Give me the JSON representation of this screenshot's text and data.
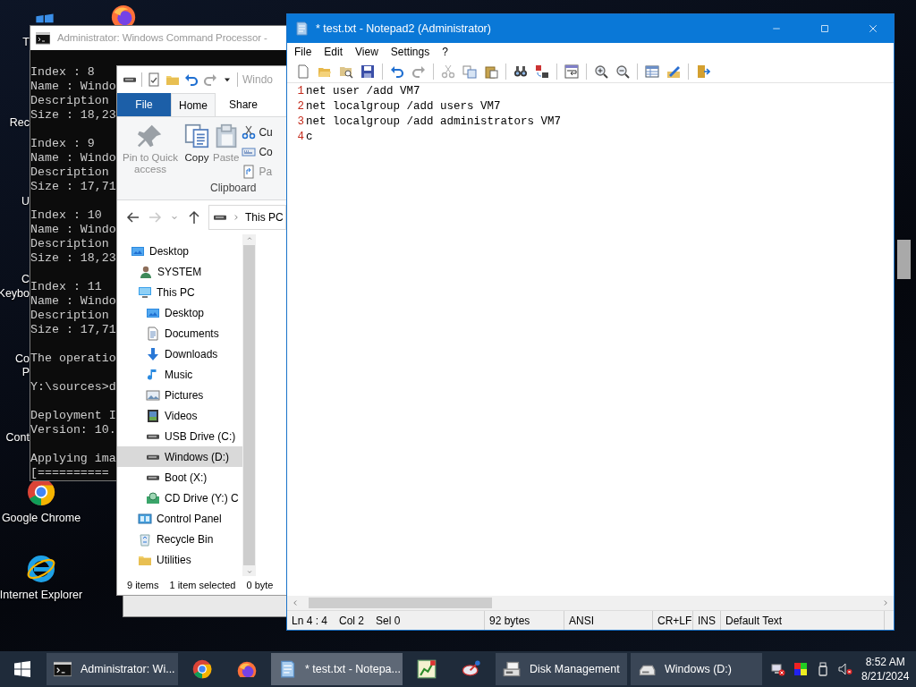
{
  "desktop": {
    "icons": [
      {
        "lines": [
          "T"
        ]
      },
      {
        "lines": [
          "Rec"
        ]
      },
      {
        "lines": [
          "U"
        ]
      },
      {
        "lines": [
          "C",
          "Keybo"
        ]
      },
      {
        "lines": [
          "Co",
          "P"
        ]
      },
      {
        "lines": [
          "Cont"
        ]
      },
      {
        "lines": [
          "Google Chrome"
        ]
      },
      {
        "lines": [
          "Internet Explorer"
        ]
      }
    ]
  },
  "command_window": {
    "title": "Administrator: Windows Command Processor -",
    "blocks": [
      [
        "Index : 8",
        "Name : Windo",
        "Description",
        "Size : 18,23"
      ],
      [
        "Index : 9",
        "Name : Windo",
        "Description",
        "Size : 17,71"
      ],
      [
        "Index : 10",
        "Name : Windo",
        "Description",
        "Size : 18,23"
      ],
      [
        "Index : 11",
        "Name : Windo",
        "Description",
        "Size : 17,71"
      ],
      [
        "The operatio"
      ],
      [
        "Y:\\sources>d"
      ],
      [
        "Deployment I",
        "Version: 10."
      ],
      [
        "Applying ima",
        "[=========="
      ]
    ]
  },
  "explorer": {
    "title": "Windo",
    "tabs": [
      {
        "label": "File",
        "kind": "file",
        "selected": false
      },
      {
        "label": "Home",
        "kind": "tab",
        "selected": true
      },
      {
        "label": "Share",
        "kind": "tab",
        "selected": false
      }
    ],
    "ribbon": {
      "large_buttons": [
        {
          "label": "Pin to Quick access",
          "disabled": true
        },
        {
          "label": "Copy",
          "disabled": false
        },
        {
          "label": "Paste",
          "disabled": true
        }
      ],
      "small_buttons": [
        {
          "label": "Cu",
          "disabled": false
        },
        {
          "label": "Co",
          "disabled": false
        },
        {
          "label": "Pa",
          "disabled": true
        }
      ],
      "group": "Clipboard"
    },
    "address": "This PC",
    "tree": [
      {
        "label": "Desktop",
        "selected": false
      },
      {
        "label": "SYSTEM",
        "selected": false
      },
      {
        "label": "This PC",
        "selected": false,
        "children": [
          {
            "label": "Desktop",
            "selected": false
          },
          {
            "label": "Documents",
            "selected": false
          },
          {
            "label": "Downloads",
            "selected": false
          },
          {
            "label": "Music",
            "selected": false
          },
          {
            "label": "Pictures",
            "selected": false
          },
          {
            "label": "Videos",
            "selected": false
          },
          {
            "label": "USB Drive (C:)",
            "selected": false
          },
          {
            "label": "Windows (D:)",
            "selected": true
          },
          {
            "label": "Boot (X:)",
            "selected": false
          },
          {
            "label": "CD Drive (Y:) C",
            "selected": false
          }
        ]
      },
      {
        "label": "Control Panel",
        "selected": false
      },
      {
        "label": "Recycle Bin",
        "selected": false
      },
      {
        "label": "Utilities",
        "selected": false
      }
    ],
    "status": [
      "9 items",
      "1 item selected",
      "0 byte"
    ]
  },
  "notepad": {
    "title": "* test.txt - Notepad2 (Administrator)",
    "menu": [
      "File",
      "Edit",
      "View",
      "Settings",
      "?"
    ],
    "lines": [
      {
        "number": "1",
        "text": "net user /add VM7"
      },
      {
        "number": "2",
        "text": "net localgroup /add users VM7"
      },
      {
        "number": "3",
        "text": "net localgroup /add administrators VM7"
      },
      {
        "number": "4",
        "text": "c"
      }
    ],
    "status": [
      "Ln 4 : 4",
      "Col 2",
      "Sel 0",
      "92 bytes",
      "ANSI",
      "CR+LF",
      "INS",
      "Default Text"
    ]
  },
  "taskbar": {
    "items": [
      {
        "kind": "window",
        "label": "Administrator: Wi...",
        "selected": false
      },
      {
        "kind": "pinned",
        "selected": false
      },
      {
        "kind": "pinned",
        "selected": false
      },
      {
        "kind": "window",
        "label": "* test.txt - Notepa...",
        "selected": true
      },
      {
        "kind": "pinned",
        "selected": false
      },
      {
        "kind": "pinned",
        "selected": false
      },
      {
        "kind": "window",
        "label": "Disk Management",
        "selected": false
      },
      {
        "kind": "window",
        "label": "Windows (D:)",
        "selected": false
      }
    ],
    "clock": {
      "time": "8:52 AM",
      "date": "8/21/2024"
    }
  }
}
